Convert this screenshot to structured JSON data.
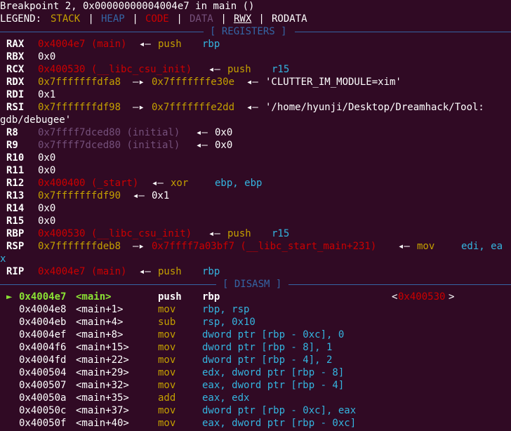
{
  "colors": {
    "background": "#300a24",
    "text": "#ffffff",
    "register_name": "#ffffff",
    "stack": "#c4a000",
    "heap": "#3465a4",
    "code": "#cc0000",
    "data": "#75507b",
    "rodata": "#ffffff",
    "mnemonic": "#c4a000",
    "operand": "#34b5e0",
    "separator": "#3465a4",
    "current_instruction": "#8ae234"
  },
  "header": {
    "breakpoint": "Breakpoint 2, 0x00000000004004e7 in main ()",
    "legend": [
      {
        "text": "LEGEND: ",
        "color": "#ffffff"
      },
      {
        "text": "STACK",
        "color": "#c4a000"
      },
      {
        "text": " | ",
        "color": "#ffffff"
      },
      {
        "text": "HEAP",
        "color": "#3465a4"
      },
      {
        "text": " | ",
        "color": "#ffffff"
      },
      {
        "text": "CODE",
        "color": "#cc0000"
      },
      {
        "text": " | ",
        "color": "#ffffff"
      },
      {
        "text": "DATA",
        "color": "#75507b"
      },
      {
        "text": " | ",
        "color": "#ffffff"
      },
      {
        "text": "RWX",
        "color": "#ffffff",
        "underline": true
      },
      {
        "text": " | ",
        "color": "#ffffff"
      },
      {
        "text": "RODATA",
        "color": "#ffffff"
      }
    ]
  },
  "registers_title": "[ REGISTERS ]",
  "registers": [
    {
      "segs": [
        {
          "c": 1,
          "t": "RAX",
          "color": "#ffffff",
          "bold": true
        },
        {
          "c": 6,
          "t": "0x4004e7 (main)",
          "color": "#cc0000"
        },
        {
          "c": 22,
          "t": "◂—",
          "color": "#ffffff"
        },
        {
          "c": 25,
          "t": "push",
          "color": "#c4a000"
        },
        {
          "c": 32,
          "t": "rbp",
          "color": "#34b5e0"
        }
      ]
    },
    {
      "segs": [
        {
          "c": 1,
          "t": "RBX",
          "color": "#ffffff",
          "bold": true
        },
        {
          "c": 6,
          "t": "0x0",
          "color": "#ffffff"
        }
      ]
    },
    {
      "segs": [
        {
          "c": 1,
          "t": "RCX",
          "color": "#ffffff",
          "bold": true
        },
        {
          "c": 6,
          "t": "0x400530 (__libc_csu_init)",
          "color": "#cc0000"
        },
        {
          "c": 33,
          "t": "◂—",
          "color": "#ffffff"
        },
        {
          "c": 36,
          "t": "push",
          "color": "#c4a000"
        },
        {
          "c": 43,
          "t": "r15",
          "color": "#34b5e0"
        }
      ]
    },
    {
      "segs": [
        {
          "c": 1,
          "t": "RDX",
          "color": "#ffffff",
          "bold": true
        },
        {
          "c": 6,
          "t": "0x7fffffffdfa8",
          "color": "#c4a000"
        },
        {
          "c": 21,
          "t": "—▸",
          "color": "#ffffff"
        },
        {
          "c": 24,
          "t": "0x7fffffffe30e",
          "color": "#c4a000"
        },
        {
          "c": 39,
          "t": "◂—",
          "color": "#ffffff"
        },
        {
          "c": 42,
          "t": "'CLUTTER_IM_MODULE=xim'",
          "color": "#ffffff"
        }
      ]
    },
    {
      "segs": [
        {
          "c": 1,
          "t": "RDI",
          "color": "#ffffff",
          "bold": true
        },
        {
          "c": 6,
          "t": "0x1",
          "color": "#ffffff"
        }
      ]
    },
    {
      "segs": [
        {
          "c": 1,
          "t": "RSI",
          "color": "#ffffff",
          "bold": true
        },
        {
          "c": 6,
          "t": "0x7fffffffdf98",
          "color": "#c4a000"
        },
        {
          "c": 21,
          "t": "—▸",
          "color": "#ffffff"
        },
        {
          "c": 24,
          "t": "0x7fffffffe2dd",
          "color": "#c4a000"
        },
        {
          "c": 39,
          "t": "◂—",
          "color": "#ffffff"
        },
        {
          "c": 42,
          "t": "'/home/hyunji/Desktop/Dreamhack/Tool:",
          "color": "#ffffff"
        }
      ]
    },
    {
      "segs": [
        {
          "c": 0,
          "t": "gdb/debugee'",
          "color": "#ffffff"
        }
      ]
    },
    {
      "segs": [
        {
          "c": 1,
          "t": "R8",
          "color": "#ffffff",
          "bold": true
        },
        {
          "c": 6,
          "t": "0x7ffff7dced80 (initial)",
          "color": "#75507b"
        },
        {
          "c": 31,
          "t": "◂—",
          "color": "#ffffff"
        },
        {
          "c": 34,
          "t": "0x0",
          "color": "#ffffff"
        }
      ]
    },
    {
      "segs": [
        {
          "c": 1,
          "t": "R9",
          "color": "#ffffff",
          "bold": true
        },
        {
          "c": 6,
          "t": "0x7ffff7dced80 (initial)",
          "color": "#75507b"
        },
        {
          "c": 31,
          "t": "◂—",
          "color": "#ffffff"
        },
        {
          "c": 34,
          "t": "0x0",
          "color": "#ffffff"
        }
      ]
    },
    {
      "segs": [
        {
          "c": 1,
          "t": "R10",
          "color": "#ffffff",
          "bold": true
        },
        {
          "c": 6,
          "t": "0x0",
          "color": "#ffffff"
        }
      ]
    },
    {
      "segs": [
        {
          "c": 1,
          "t": "R11",
          "color": "#ffffff",
          "bold": true
        },
        {
          "c": 6,
          "t": "0x0",
          "color": "#ffffff"
        }
      ]
    },
    {
      "segs": [
        {
          "c": 1,
          "t": "R12",
          "color": "#ffffff",
          "bold": true
        },
        {
          "c": 6,
          "t": "0x400400 (_start)",
          "color": "#cc0000"
        },
        {
          "c": 24,
          "t": "◂—",
          "color": "#ffffff"
        },
        {
          "c": 27,
          "t": "xor",
          "color": "#c4a000"
        },
        {
          "c": 34,
          "t": "ebp, ebp",
          "color": "#34b5e0"
        }
      ]
    },
    {
      "segs": [
        {
          "c": 1,
          "t": "R13",
          "color": "#ffffff",
          "bold": true
        },
        {
          "c": 6,
          "t": "0x7fffffffdf90",
          "color": "#c4a000"
        },
        {
          "c": 21,
          "t": "◂—",
          "color": "#ffffff"
        },
        {
          "c": 24,
          "t": "0x1",
          "color": "#ffffff"
        }
      ]
    },
    {
      "segs": [
        {
          "c": 1,
          "t": "R14",
          "color": "#ffffff",
          "bold": true
        },
        {
          "c": 6,
          "t": "0x0",
          "color": "#ffffff"
        }
      ]
    },
    {
      "segs": [
        {
          "c": 1,
          "t": "R15",
          "color": "#ffffff",
          "bold": true
        },
        {
          "c": 6,
          "t": "0x0",
          "color": "#ffffff"
        }
      ]
    },
    {
      "segs": [
        {
          "c": 1,
          "t": "RBP",
          "color": "#ffffff",
          "bold": true
        },
        {
          "c": 6,
          "t": "0x400530 (__libc_csu_init)",
          "color": "#cc0000"
        },
        {
          "c": 33,
          "t": "◂—",
          "color": "#ffffff"
        },
        {
          "c": 36,
          "t": "push",
          "color": "#c4a000"
        },
        {
          "c": 43,
          "t": "r15",
          "color": "#34b5e0"
        }
      ]
    },
    {
      "segs": [
        {
          "c": 1,
          "t": "RSP",
          "color": "#ffffff",
          "bold": true
        },
        {
          "c": 6,
          "t": "0x7fffffffdeb8",
          "color": "#c4a000"
        },
        {
          "c": 21,
          "t": "—▸",
          "color": "#ffffff"
        },
        {
          "c": 24,
          "t": "0x7ffff7a03bf7 (__libc_start_main+231)",
          "color": "#cc0000"
        },
        {
          "c": 63,
          "t": "◂—",
          "color": "#ffffff"
        },
        {
          "c": 66,
          "t": "mov",
          "color": "#c4a000"
        },
        {
          "c": 73,
          "t": "edi, ea",
          "color": "#34b5e0"
        }
      ]
    },
    {
      "segs": [
        {
          "c": 0,
          "t": "x",
          "color": "#34b5e0"
        }
      ]
    },
    {
      "segs": [
        {
          "c": 1,
          "t": "RIP",
          "color": "#ffffff",
          "bold": true
        },
        {
          "c": 6,
          "t": "0x4004e7 (main)",
          "color": "#cc0000"
        },
        {
          "c": 22,
          "t": "◂—",
          "color": "#ffffff"
        },
        {
          "c": 25,
          "t": "push",
          "color": "#c4a000"
        },
        {
          "c": 32,
          "t": "rbp",
          "color": "#34b5e0"
        }
      ]
    }
  ],
  "disasm_title": "[ DISASM ]",
  "disasm": [
    {
      "current": true,
      "segs": [
        {
          "c": 1,
          "t": "►",
          "color": "#8ae234"
        },
        {
          "c": 3,
          "t": "0x4004e7",
          "color": "#8ae234",
          "bold": true
        },
        {
          "c": 12,
          "t": "<main>",
          "color": "#8ae234",
          "bold": true
        },
        {
          "c": 25,
          "t": "push",
          "color": "#ffffff",
          "bold": true
        },
        {
          "c": 32,
          "t": "rbp",
          "color": "#ffffff",
          "bold": true
        },
        {
          "c": 62,
          "t": "<",
          "color": "#ffffff"
        },
        {
          "c": 63,
          "t": "0x400530",
          "color": "#cc0000"
        },
        {
          "c": 71,
          "t": ">",
          "color": "#ffffff"
        }
      ]
    },
    {
      "segs": [
        {
          "c": 3,
          "t": "0x4004e8",
          "color": "#ffffff"
        },
        {
          "c": 12,
          "t": "<main+1>",
          "color": "#ffffff"
        },
        {
          "c": 25,
          "t": "mov",
          "color": "#c4a000"
        },
        {
          "c": 32,
          "t": "rbp, rsp",
          "color": "#34b5e0"
        }
      ]
    },
    {
      "segs": [
        {
          "c": 3,
          "t": "0x4004eb",
          "color": "#ffffff"
        },
        {
          "c": 12,
          "t": "<main+4>",
          "color": "#ffffff"
        },
        {
          "c": 25,
          "t": "sub",
          "color": "#c4a000"
        },
        {
          "c": 32,
          "t": "rsp, 0x10",
          "color": "#34b5e0"
        }
      ]
    },
    {
      "segs": [
        {
          "c": 3,
          "t": "0x4004ef",
          "color": "#ffffff"
        },
        {
          "c": 12,
          "t": "<main+8>",
          "color": "#ffffff"
        },
        {
          "c": 25,
          "t": "mov",
          "color": "#c4a000"
        },
        {
          "c": 32,
          "t": "dword ptr [rbp - 0xc], 0",
          "color": "#34b5e0"
        }
      ]
    },
    {
      "segs": [
        {
          "c": 3,
          "t": "0x4004f6",
          "color": "#ffffff"
        },
        {
          "c": 12,
          "t": "<main+15>",
          "color": "#ffffff"
        },
        {
          "c": 25,
          "t": "mov",
          "color": "#c4a000"
        },
        {
          "c": 32,
          "t": "dword ptr [rbp - 8], 1",
          "color": "#34b5e0"
        }
      ]
    },
    {
      "segs": [
        {
          "c": 3,
          "t": "0x4004fd",
          "color": "#ffffff"
        },
        {
          "c": 12,
          "t": "<main+22>",
          "color": "#ffffff"
        },
        {
          "c": 25,
          "t": "mov",
          "color": "#c4a000"
        },
        {
          "c": 32,
          "t": "dword ptr [rbp - 4], 2",
          "color": "#34b5e0"
        }
      ]
    },
    {
      "segs": [
        {
          "c": 3,
          "t": "0x400504",
          "color": "#ffffff"
        },
        {
          "c": 12,
          "t": "<main+29>",
          "color": "#ffffff"
        },
        {
          "c": 25,
          "t": "mov",
          "color": "#c4a000"
        },
        {
          "c": 32,
          "t": "edx, dword ptr [rbp - 8]",
          "color": "#34b5e0"
        }
      ]
    },
    {
      "segs": [
        {
          "c": 3,
          "t": "0x400507",
          "color": "#ffffff"
        },
        {
          "c": 12,
          "t": "<main+32>",
          "color": "#ffffff"
        },
        {
          "c": 25,
          "t": "mov",
          "color": "#c4a000"
        },
        {
          "c": 32,
          "t": "eax, dword ptr [rbp - 4]",
          "color": "#34b5e0"
        }
      ]
    },
    {
      "segs": [
        {
          "c": 3,
          "t": "0x40050a",
          "color": "#ffffff"
        },
        {
          "c": 12,
          "t": "<main+35>",
          "color": "#ffffff"
        },
        {
          "c": 25,
          "t": "add",
          "color": "#c4a000"
        },
        {
          "c": 32,
          "t": "eax, edx",
          "color": "#34b5e0"
        }
      ]
    },
    {
      "segs": [
        {
          "c": 3,
          "t": "0x40050c",
          "color": "#ffffff"
        },
        {
          "c": 12,
          "t": "<main+37>",
          "color": "#ffffff"
        },
        {
          "c": 25,
          "t": "mov",
          "color": "#c4a000"
        },
        {
          "c": 32,
          "t": "dword ptr [rbp - 0xc], eax",
          "color": "#34b5e0"
        }
      ]
    },
    {
      "segs": [
        {
          "c": 3,
          "t": "0x40050f",
          "color": "#ffffff"
        },
        {
          "c": 12,
          "t": "<main+40>",
          "color": "#ffffff"
        },
        {
          "c": 25,
          "t": "mov",
          "color": "#c4a000"
        },
        {
          "c": 32,
          "t": "eax, dword ptr [rbp - 0xc]",
          "color": "#34b5e0"
        }
      ]
    }
  ]
}
